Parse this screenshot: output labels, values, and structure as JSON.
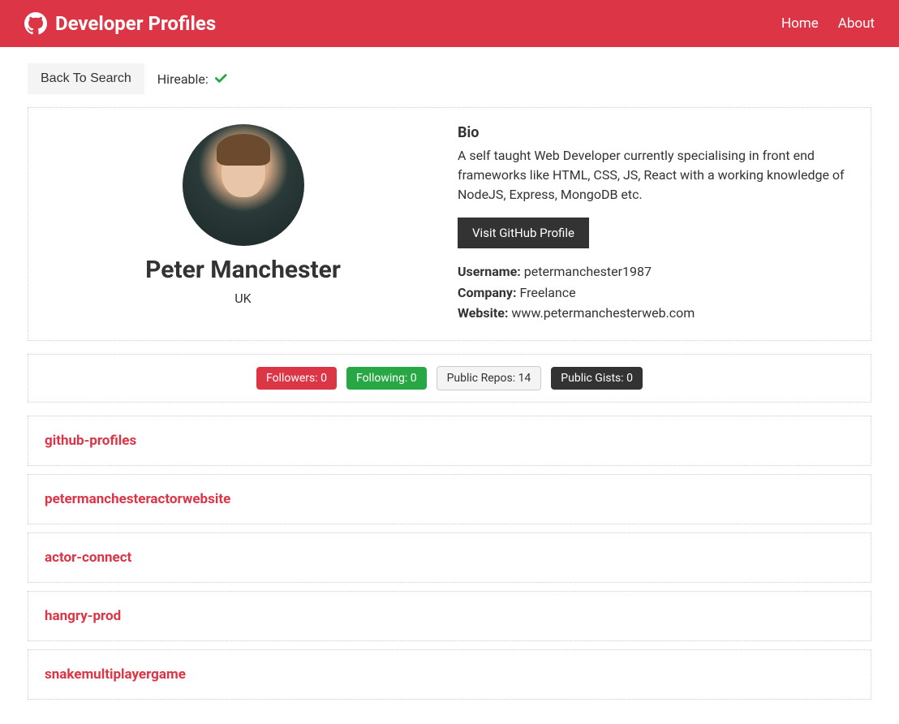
{
  "navbar": {
    "brand": "Developer Profiles",
    "links": {
      "home": "Home",
      "about": "About"
    }
  },
  "top": {
    "back_button": "Back To Search",
    "hireable_label": "Hireable: "
  },
  "profile": {
    "name": "Peter Manchester",
    "location": "UK",
    "bio_heading": "Bio",
    "bio": "A self taught Web Developer currently specialising in front end frameworks like HTML, CSS, JS, React with a working knowledge of NodeJS, Express, MongoDB etc.",
    "visit_button": "Visit GitHub Profile",
    "username_label": "Username: ",
    "username": "petermanchester1987",
    "company_label": "Company: ",
    "company": "Freelance",
    "website_label": "Website: ",
    "website": "www.petermanchesterweb.com"
  },
  "stats": {
    "followers": "Followers: 0",
    "following": "Following: 0",
    "public_repos": "Public Repos: 14",
    "public_gists": "Public Gists: 0"
  },
  "repos": [
    {
      "name": "github-profiles"
    },
    {
      "name": "petermanchesteractorwebsite"
    },
    {
      "name": "actor-connect"
    },
    {
      "name": "hangry-prod"
    },
    {
      "name": "snakemultiplayergame"
    }
  ]
}
